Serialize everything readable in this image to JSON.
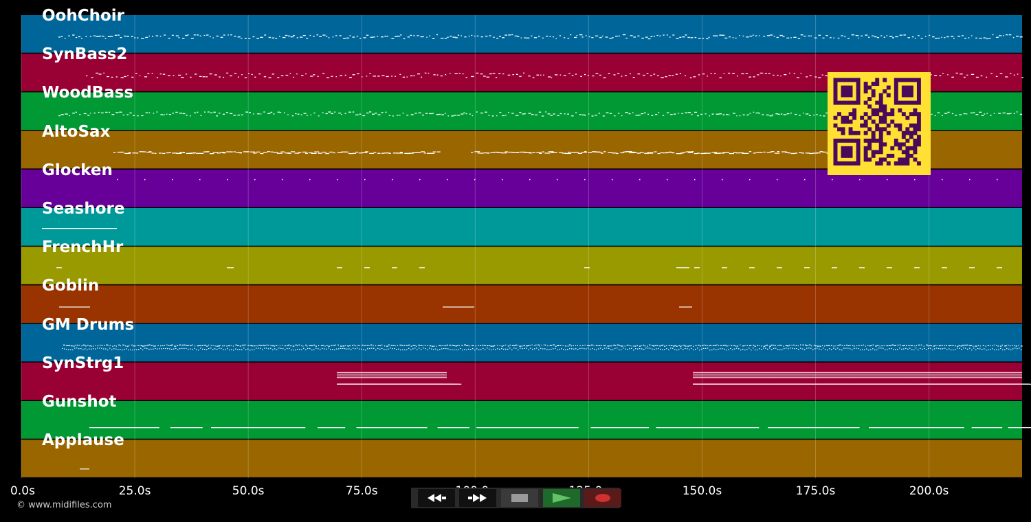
{
  "tracks": [
    {
      "name": "OohChoir",
      "color": "#006699"
    },
    {
      "name": "SynBass2",
      "color": "#990033"
    },
    {
      "name": "WoodBass",
      "color": "#009933"
    },
    {
      "name": "AltoSax",
      "color": "#996600"
    },
    {
      "name": "Glocken",
      "color": "#660099"
    },
    {
      "name": "Seashore",
      "color": "#009999"
    },
    {
      "name": "FrenchHr",
      "color": "#999900"
    },
    {
      "name": "Goblin",
      "color": "#993300"
    },
    {
      "name": "GM Drums",
      "color": "#006699"
    },
    {
      "name": "SynStrg1",
      "color": "#990033"
    },
    {
      "name": "Gunshot",
      "color": "#009933"
    },
    {
      "name": "Applause",
      "color": "#996600"
    }
  ],
  "timeline": {
    "ticks": [
      "0.0s",
      "25.0s",
      "50.0s",
      "75.0s",
      "100.0s",
      "125.0s",
      "150.0s",
      "175.0s",
      "200.0s"
    ],
    "tick_values": [
      0,
      25,
      50,
      75,
      100,
      125,
      150,
      175,
      200
    ],
    "duration": 220.5
  },
  "copyright": "© www.midifiles.com",
  "transport": {
    "rewind_icon": "rewind-icon",
    "fast_forward_icon": "fast-forward-icon",
    "stop_icon": "stop-icon",
    "play_icon": "play-icon",
    "record_icon": "record-icon"
  },
  "colors": {
    "background": "#000000",
    "note": "#ffffff",
    "qr_background": "#ffe033",
    "qr_foreground": "#4a0a5a"
  }
}
